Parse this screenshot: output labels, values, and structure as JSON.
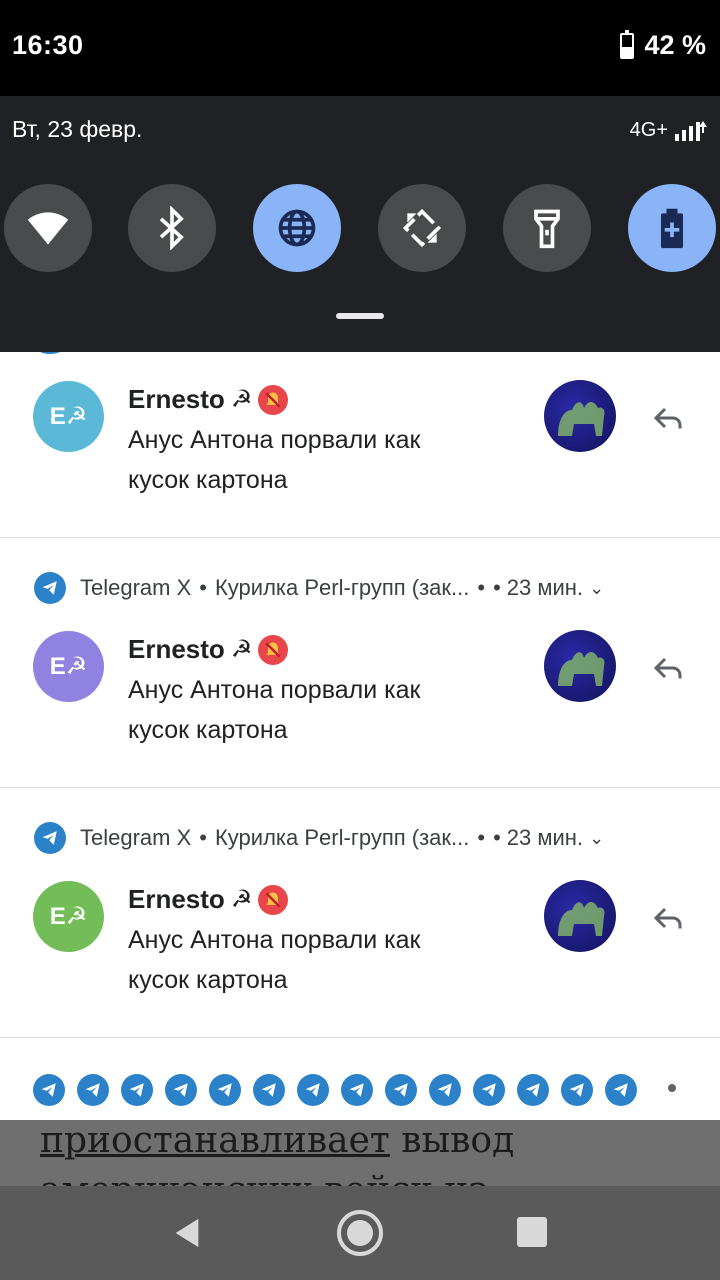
{
  "status_bar": {
    "time": "16:30",
    "battery": "42 %",
    "battery_level": 0.42
  },
  "quick_settings": {
    "date": "Вт, 23 февр.",
    "network": "4G+",
    "tiles": [
      {
        "name": "wifi",
        "on": false
      },
      {
        "name": "bluetooth",
        "on": false
      },
      {
        "name": "data-saver-globe",
        "on": true
      },
      {
        "name": "auto-rotate",
        "on": false
      },
      {
        "name": "flashlight",
        "on": false
      },
      {
        "name": "battery-saver",
        "on": true
      }
    ]
  },
  "notifications": [
    {
      "app": "",
      "chat": "",
      "time": "",
      "sender": "Ernesto",
      "sender_symbol": "☭",
      "avatar_initials": "E☭",
      "avatar_color": "#5bb8d6",
      "line1": "Анус Антона порвали как",
      "line2": "кусок картона"
    },
    {
      "app": "Telegram X",
      "chat": "Курилка Perl-групп (зак...",
      "time": "23 мин.",
      "sender": "Ernesto",
      "sender_symbol": "☭",
      "avatar_initials": "E☭",
      "avatar_color": "#8f82e0",
      "line1": "Анус Антона порвали как",
      "line2": "кусок картона"
    },
    {
      "app": "Telegram X",
      "chat": "Курилка Perl-групп (зак...",
      "time": "23 мин.",
      "sender": "Ernesto",
      "sender_symbol": "☭",
      "avatar_initials": "E☭",
      "avatar_color": "#73bd59",
      "line1": "Анус Антона порвали как",
      "line2": "кусок картона"
    }
  ],
  "collapsed_count": 14,
  "background_article": {
    "line1_underlined": "приостанавливает",
    "line1_rest": " вывод",
    "line2": "американских войск из"
  }
}
